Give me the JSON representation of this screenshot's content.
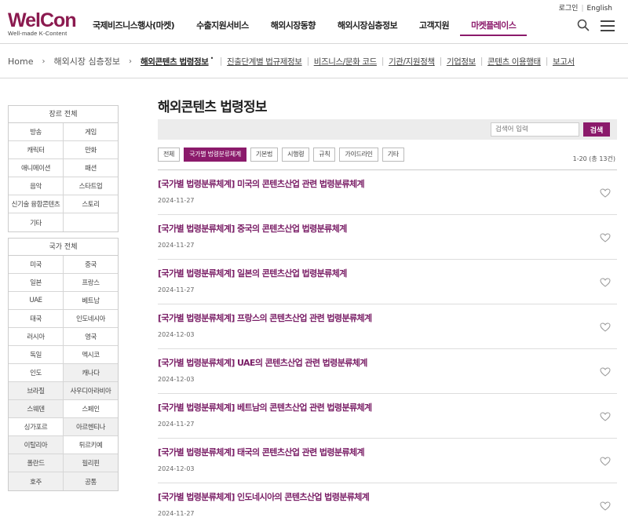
{
  "logo": {
    "main": "WelCon",
    "sub": "Well-made K-Content"
  },
  "util": {
    "login": "로그인",
    "english": "English"
  },
  "gnb": [
    {
      "label": "국제비즈니스행사(마켓)"
    },
    {
      "label": "수출지원서비스"
    },
    {
      "label": "해외시장동향"
    },
    {
      "label": "해외시장심층정보"
    },
    {
      "label": "고객지원"
    },
    {
      "label": "마켓플레이스"
    }
  ],
  "icons": {
    "search": "search-icon",
    "menu": "hamburger-menu-icon",
    "arrow": "chevron-right-icon",
    "heart": "heart-outline-icon"
  },
  "colors": {
    "brand": "#8b1a6b",
    "logo": "#8b1a4f"
  },
  "breadcrumb": {
    "home": "Home",
    "arrow": "›",
    "level1": "해외시장 심층정보",
    "dot": "•",
    "bar": "|",
    "sub": [
      {
        "label": "해외콘텐츠 법령정보"
      },
      {
        "label": "진출단계별 법규제정보"
      },
      {
        "label": "비즈니스/문화 코드"
      },
      {
        "label": "기관/지원정책"
      },
      {
        "label": "기업정보"
      },
      {
        "label": "콘텐츠 이용행태"
      },
      {
        "label": "보고서"
      }
    ]
  },
  "side_genre": {
    "header": "장르 전체",
    "rows": [
      [
        "방송",
        "게임"
      ],
      [
        "캐릭터",
        "만화"
      ],
      [
        "애니메이션",
        "패션"
      ],
      [
        "음악",
        "스타트업"
      ],
      [
        "신기술 융합콘텐츠",
        "스토리"
      ],
      [
        "기타",
        ""
      ]
    ]
  },
  "side_country": {
    "header": "국가 전체",
    "rows": [
      [
        "미국",
        "중국"
      ],
      [
        "일본",
        "프랑스"
      ],
      [
        "UAE",
        "베트남"
      ],
      [
        "태국",
        "인도네시아"
      ],
      [
        "러시아",
        "영국"
      ],
      [
        "독일",
        "멕시코"
      ],
      [
        "인도",
        "캐나다"
      ],
      [
        "브라질",
        "사우디아라비아"
      ],
      [
        "스웨덴",
        "스페인"
      ],
      [
        "싱가포르",
        "아르헨티나"
      ],
      [
        "이탈리아",
        "튀르키예"
      ],
      [
        "폴란드",
        "필리핀"
      ],
      [
        "호주",
        "공통"
      ]
    ]
  },
  "main": {
    "title": "해외콘텐츠 법령정보",
    "search_placeholder": "검색어 입력",
    "search_button": "검색",
    "chips": [
      "전체",
      "국가별 법령분류체계",
      "기본법",
      "시행령",
      "규칙",
      "가이드라인",
      "기타"
    ],
    "result_count": "1-20 (총 13건)",
    "posts": [
      {
        "title": "[국가별 법령분류체계] 미국의 콘텐츠산업 관련 법령분류체계",
        "date": "2024-11-27"
      },
      {
        "title": "[국가별 법령분류체계] 중국의 콘텐츠산업 법령분류체계",
        "date": "2024-11-27"
      },
      {
        "title": "[국가별 법령분류체계] 일본의 콘텐츠산업 법령분류체계",
        "date": "2024-11-27"
      },
      {
        "title": "[국가별 법령분류체계] 프랑스의 콘텐츠산업 관련 법령분류체계",
        "date": "2024-12-03"
      },
      {
        "title": "[국가별 법령분류체계] UAE의 콘텐츠산업 관련 법령분류체계",
        "date": "2024-12-03"
      },
      {
        "title": "[국가별 법령분류체계] 베트남의 콘텐츠산업 관련 법령분류체계",
        "date": "2024-11-27"
      },
      {
        "title": "[국가별 법령분류체계] 태국의 콘텐츠산업 관련 법령분류체계",
        "date": "2024-12-03"
      },
      {
        "title": "[국가별 법령분류체계] 인도네시아의 콘텐츠산업 법령분류체계",
        "date": "2024-11-27"
      }
    ]
  }
}
